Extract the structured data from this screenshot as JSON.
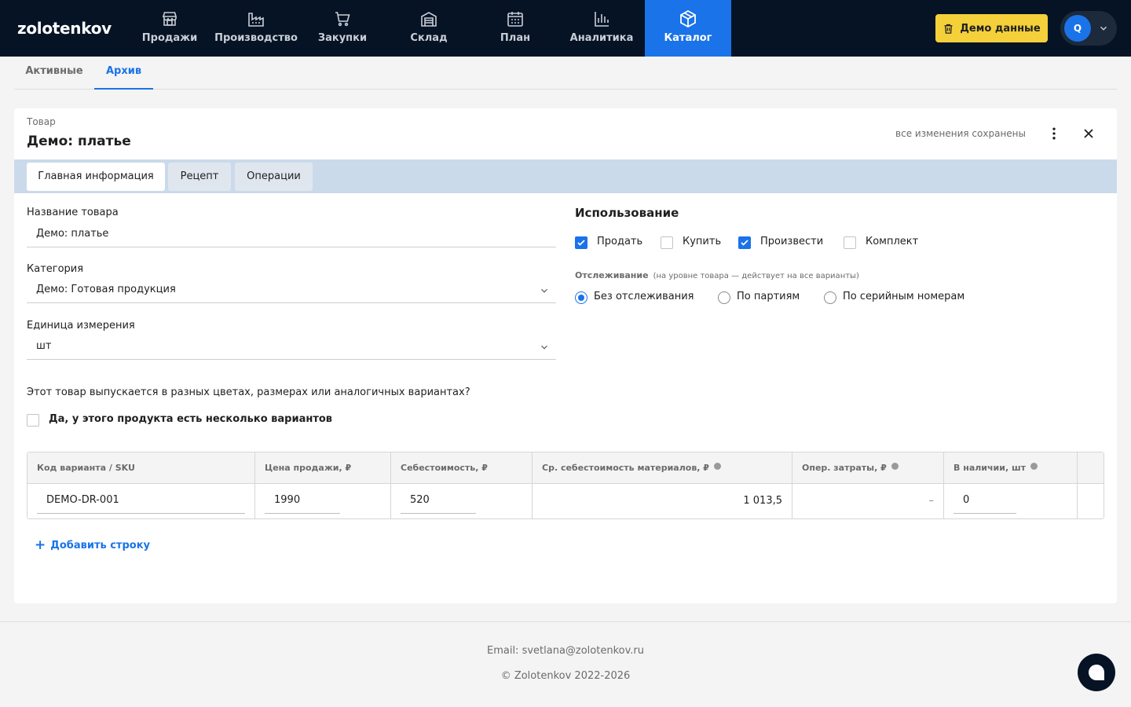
{
  "app": {
    "logo": "zolotenkov"
  },
  "nav": [
    {
      "label": "Продажи",
      "icon": "store-icon"
    },
    {
      "label": "Производство",
      "icon": "factory-icon"
    },
    {
      "label": "Закупки",
      "icon": "cart-icon"
    },
    {
      "label": "Склад",
      "icon": "warehouse-icon"
    },
    {
      "label": "План",
      "icon": "calendar-icon"
    },
    {
      "label": "Аналитика",
      "icon": "bar-chart-icon"
    },
    {
      "label": "Каталог",
      "icon": "box-icon",
      "active": true
    }
  ],
  "header": {
    "demo_button": "Демо данные",
    "avatar_initial": "Q"
  },
  "subtabs": {
    "active_tab": "Активные",
    "archive_tab": "Архив"
  },
  "item": {
    "crumb": "Товар",
    "title": "Демо: платье",
    "saved_status": "все изменения сохранены"
  },
  "form_tabs": {
    "main": "Главная информация",
    "recipe": "Рецепт",
    "operations": "Операции"
  },
  "fields": {
    "name_label": "Название товара",
    "name_value": "Демо: платье",
    "category_label": "Категория",
    "category_value": "Демо: Готовая продукция",
    "unit_label": "Единица измерения",
    "unit_value": "шт"
  },
  "variants": {
    "question": "Этот товар выпускается в разных цветах, размерах или аналогичных вариантах?",
    "checkbox_label": "Да, у этого продукта есть несколько вариантов"
  },
  "usage": {
    "title": "Использование",
    "sell": "Продать",
    "buy": "Купить",
    "produce": "Произвести",
    "kit": "Комплект"
  },
  "tracking": {
    "label": "Отслеживание",
    "note": "(на уровне товара — действует на все варианты)",
    "none": "Без отслеживания",
    "batch": "По партиям",
    "serial": "По серийным номерам"
  },
  "table": {
    "headers": {
      "sku": "Код варианта / SKU",
      "price": "Цена продажи, ₽",
      "cost": "Себестоимость, ₽",
      "avg_material": "Ср. себестоимость материалов, ₽",
      "op_cost": "Опер. затраты, ₽",
      "stock": "В наличии, шт"
    },
    "row": {
      "sku": "DEMO-DR-001",
      "price": "1990",
      "cost": "520",
      "avg_material": "1 013,5",
      "op_cost": "–",
      "stock": "0"
    },
    "add_row": "Добавить строку"
  },
  "footer": {
    "email": "Email: svetlana@zolotenkov.ru",
    "copyright": "© Zolotenkov 2022-2026"
  }
}
